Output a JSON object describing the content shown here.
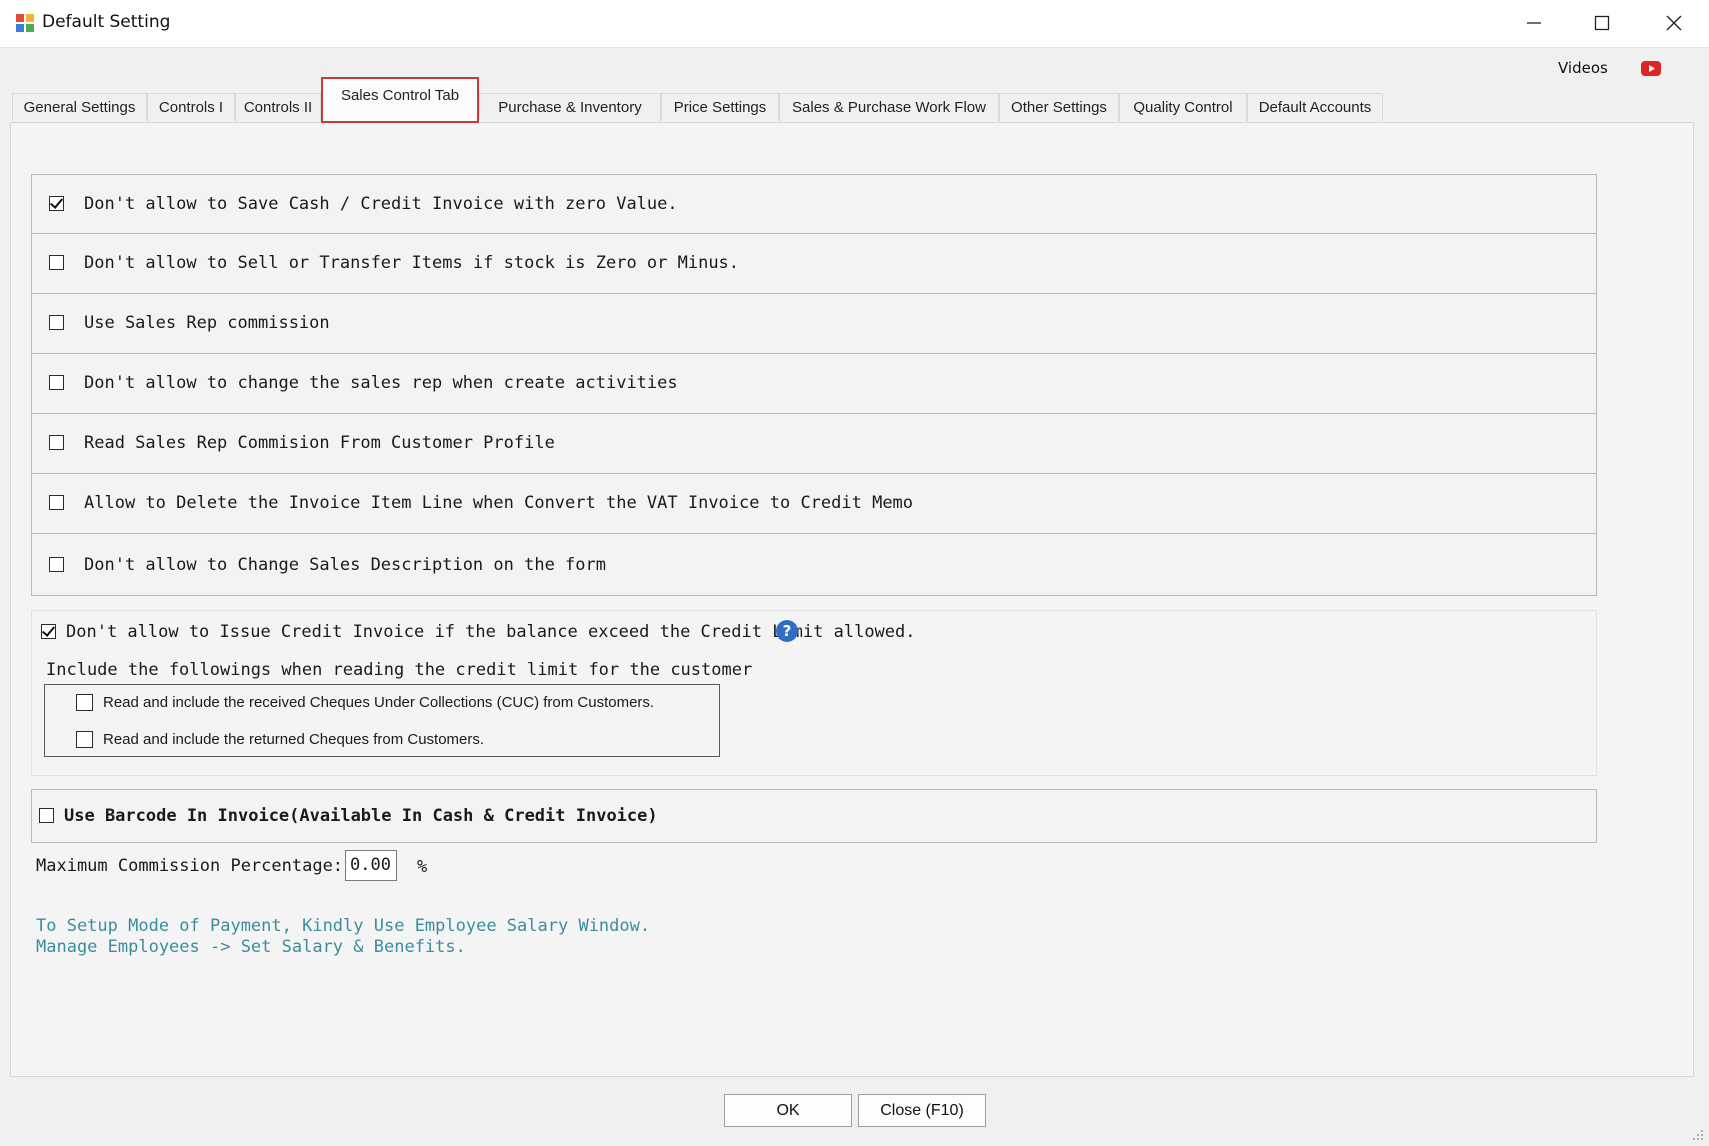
{
  "window": {
    "title": "Default Setting"
  },
  "header": {
    "videos_label": "Videos"
  },
  "tabs": [
    {
      "label": "General Settings"
    },
    {
      "label": "Controls I"
    },
    {
      "label": "Controls II"
    },
    {
      "label": "Sales Control Tab",
      "active": true
    },
    {
      "label": "Purchase & Inventory"
    },
    {
      "label": "Price Settings"
    },
    {
      "label": "Sales & Purchase Work Flow"
    },
    {
      "label": "Other Settings"
    },
    {
      "label": "Quality Control"
    },
    {
      "label": "Default Accounts"
    }
  ],
  "options": [
    {
      "label": "Don't allow to Save Cash / Credit Invoice with zero Value.",
      "checked": true
    },
    {
      "label": "Don't allow to Sell or Transfer Items if stock is Zero or Minus.",
      "checked": false
    },
    {
      "label": "Use Sales Rep commission",
      "checked": false
    },
    {
      "label": "Don't allow to change the sales rep when create activities",
      "checked": false
    },
    {
      "label": "Read Sales Rep Commision From Customer Profile",
      "checked": false
    },
    {
      "label": "Allow to Delete the Invoice Item Line when Convert the VAT Invoice to Credit Memo",
      "checked": false
    },
    {
      "label": "Don't allow to Change Sales Description on the form",
      "checked": false
    }
  ],
  "credit_limit": {
    "label": "Don't allow to Issue Credit Invoice if the balance exceed the Credit Limit allowed.",
    "checked": true,
    "include_heading": "Include the followings when reading the credit limit for the customer",
    "sub_options": [
      {
        "label": "Read and include the received Cheques Under Collections (CUC) from Customers.",
        "checked": false
      },
      {
        "label": "Read and include the returned Cheques from Customers.",
        "checked": false
      }
    ]
  },
  "barcode": {
    "label": "Use Barcode In Invoice(Available In Cash & Credit Invoice)",
    "checked": false
  },
  "commission": {
    "label": "Maximum Commission Percentage:",
    "value": "0.00",
    "unit": "%"
  },
  "notes": [
    "To Setup Mode of Payment, Kindly Use Employee Salary Window.",
    "Manage Employees -> Set Salary & Benefits."
  ],
  "footer": {
    "ok_label": "OK",
    "close_label": "Close (F10)"
  },
  "colors": {
    "active_tab_border": "#c63a3a",
    "note_text": "#3c8d9c",
    "help_icon": "#2f6fc1",
    "youtube_red": "#e02424"
  }
}
